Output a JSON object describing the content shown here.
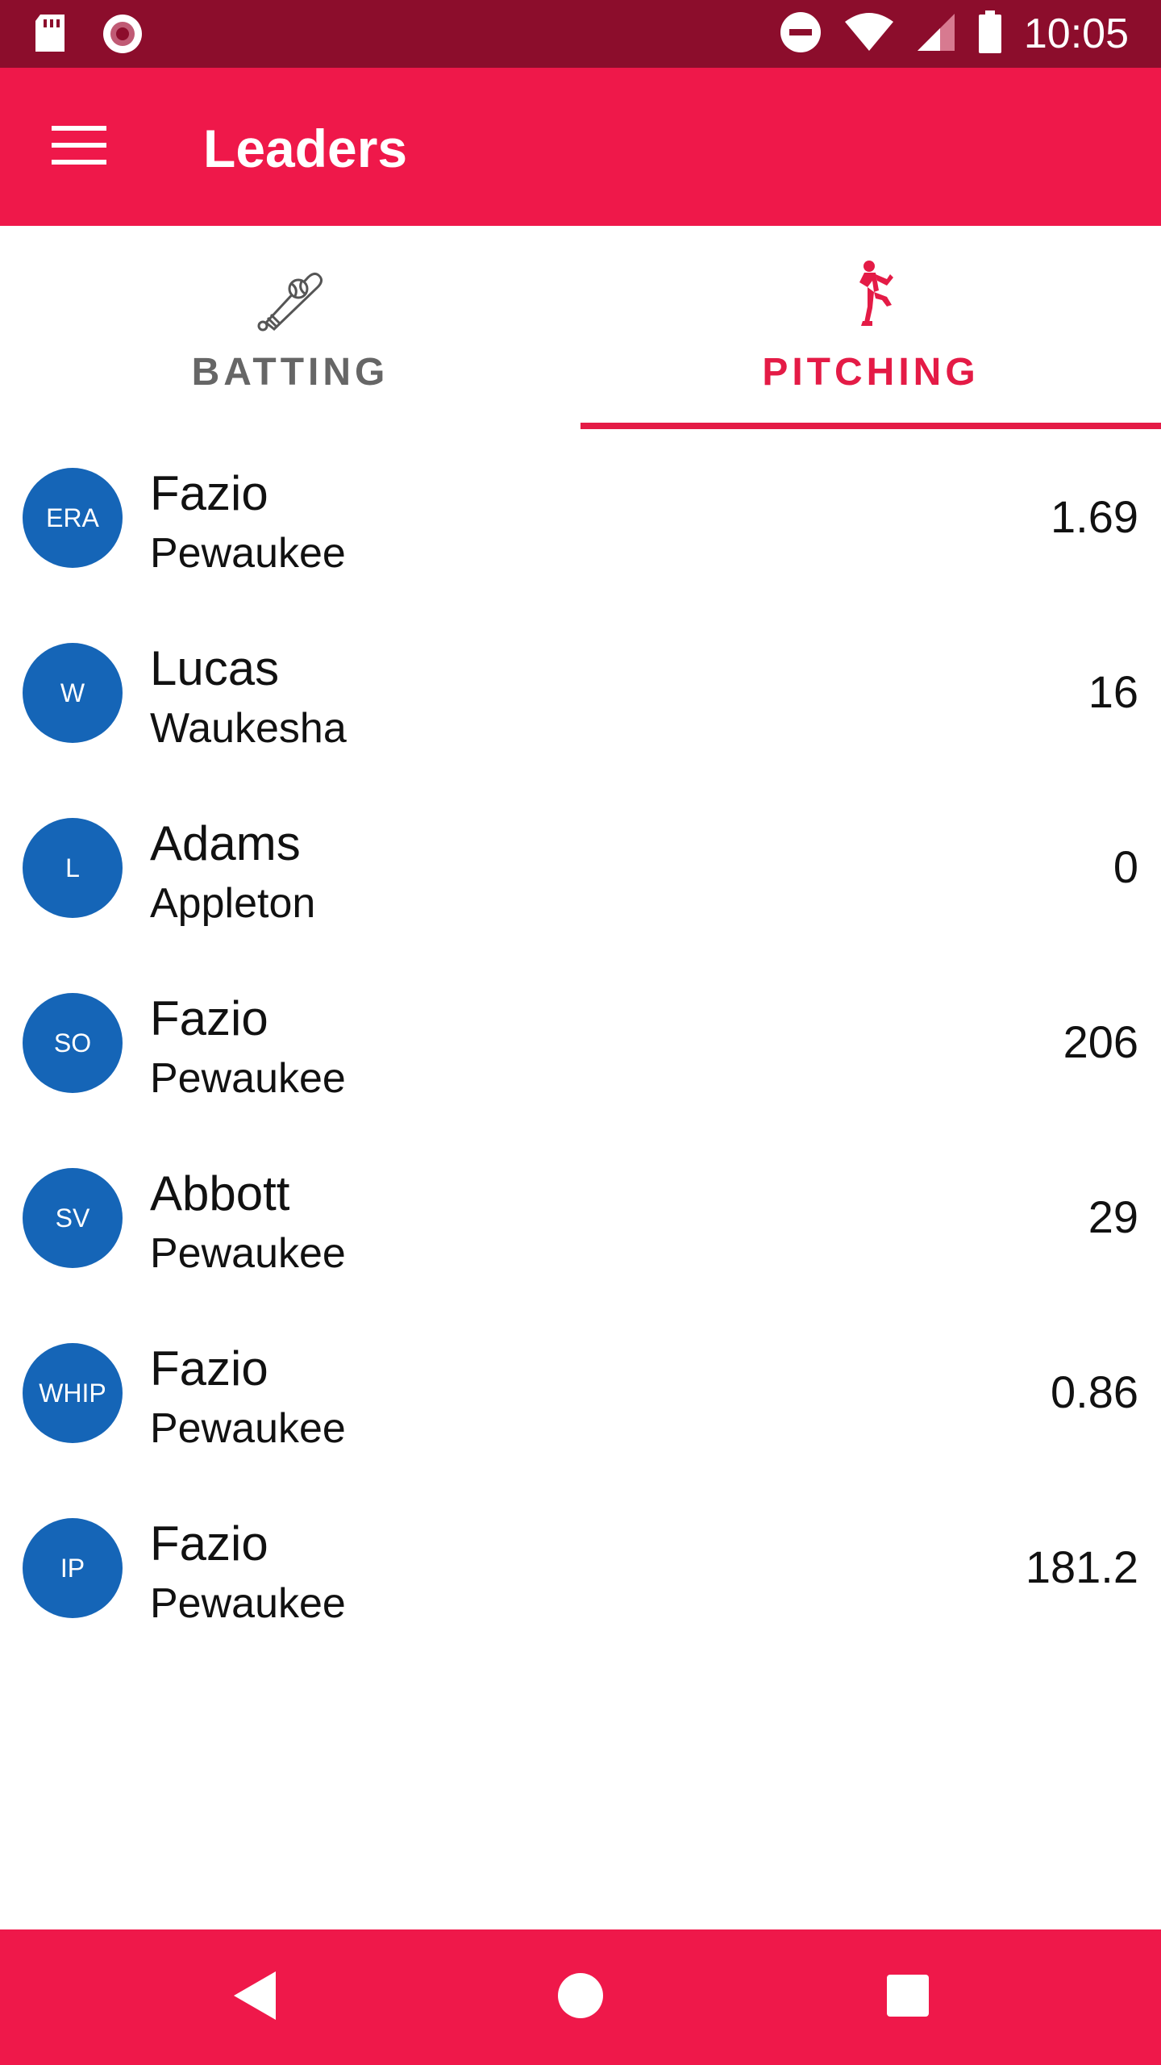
{
  "status_bar": {
    "time": "10:05",
    "icons": [
      "sd-card-icon",
      "record-icon",
      "do-not-disturb-icon",
      "wifi-icon",
      "cell-signal-icon",
      "battery-icon"
    ]
  },
  "app_bar": {
    "title": "Leaders",
    "menu_icon": "hamburger-menu-icon"
  },
  "tabs": [
    {
      "label": "BATTING",
      "icon": "baseball-bat-icon",
      "selected": false
    },
    {
      "label": "PITCHING",
      "icon": "pitcher-icon",
      "selected": true
    }
  ],
  "leaders": [
    {
      "stat": "ERA",
      "name": "Fazio",
      "team": "Pewaukee",
      "value": "1.69"
    },
    {
      "stat": "W",
      "name": "Lucas",
      "team": "Waukesha",
      "value": "16"
    },
    {
      "stat": "L",
      "name": "Adams",
      "team": "Appleton",
      "value": "0"
    },
    {
      "stat": "SO",
      "name": "Fazio",
      "team": "Pewaukee",
      "value": "206"
    },
    {
      "stat": "SV",
      "name": "Abbott",
      "team": "Pewaukee",
      "value": "29"
    },
    {
      "stat": "WHIP",
      "name": "Fazio",
      "team": "Pewaukee",
      "value": "0.86"
    },
    {
      "stat": "IP",
      "name": "Fazio",
      "team": "Pewaukee",
      "value": "181.2"
    }
  ],
  "colors": {
    "status_bar": "#8c0d2c",
    "app_bar": "#ef184a",
    "accent": "#e41b46",
    "badge": "#1565b7",
    "inactive_tab": "#666666"
  },
  "nav_bar": {
    "icons": [
      "back-icon",
      "home-icon",
      "recents-icon"
    ]
  }
}
